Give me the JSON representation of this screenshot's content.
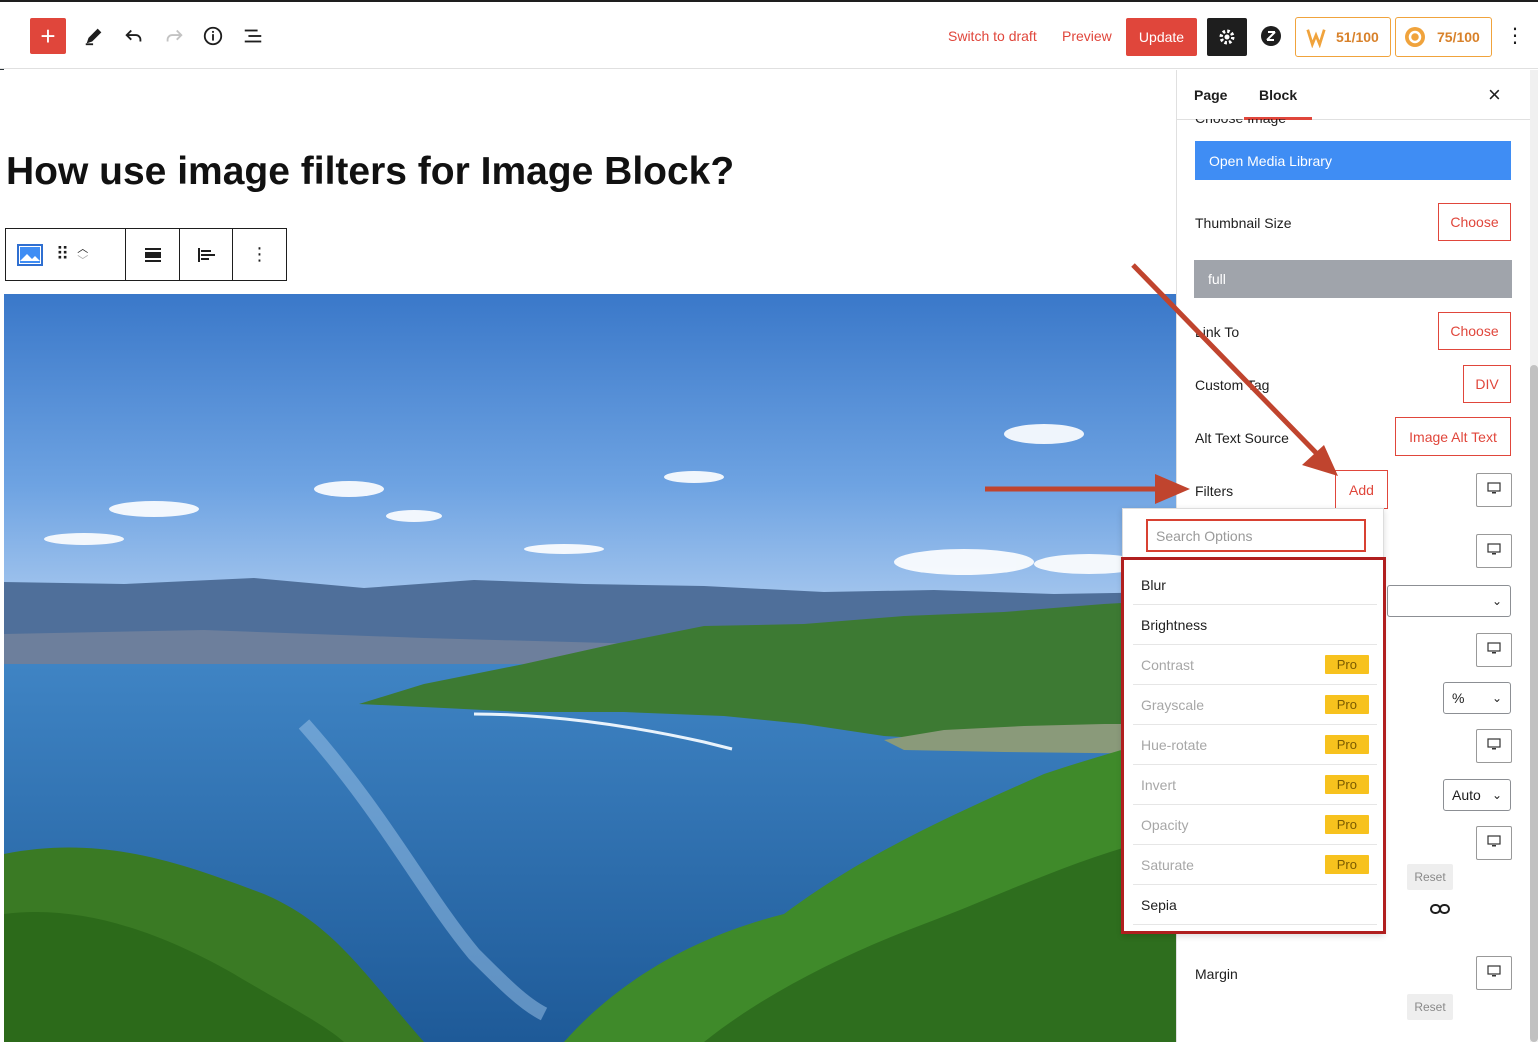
{
  "toolbar": {
    "switch_to_draft": "Switch to draft",
    "preview": "Preview",
    "update": "Update",
    "score1": "51/100",
    "score2": "75/100"
  },
  "editor": {
    "title": "How use image filters for Image Block?"
  },
  "sidebar": {
    "tabs": [
      "Page",
      "Block"
    ],
    "active_tab": "Block",
    "partial_label": "Choose Image",
    "open_media_library": "Open Media Library",
    "thumbnail_size_label": "Thumbnail Size",
    "choose_label": "Choose",
    "thumbnail_value": "full",
    "link_to_label": "Link To",
    "custom_tag_label": "Custom Tag",
    "custom_tag_value": "DIV",
    "alt_text_source_label": "Alt Text Source",
    "alt_text_source_value": "Image Alt Text",
    "filters_label": "Filters",
    "add_label": "Add",
    "unit_select": "%",
    "auto_select": "Auto",
    "reset_label": "Reset",
    "margin_label": "Margin"
  },
  "filters_dropdown": {
    "search_placeholder": "Search Options",
    "items": [
      {
        "label": "Blur",
        "pro": false
      },
      {
        "label": "Brightness",
        "pro": false
      },
      {
        "label": "Contrast",
        "pro": true
      },
      {
        "label": "Grayscale",
        "pro": true
      },
      {
        "label": "Hue-rotate",
        "pro": true
      },
      {
        "label": "Invert",
        "pro": true
      },
      {
        "label": "Opacity",
        "pro": true
      },
      {
        "label": "Saturate",
        "pro": true
      },
      {
        "label": "Sepia",
        "pro": false
      }
    ],
    "pro_label": "Pro"
  },
  "colors": {
    "accent": "#e0463b",
    "media_button": "#3f8df4",
    "pro_badge": "#f7c21e",
    "annotation_arrow": "#c0442e"
  }
}
